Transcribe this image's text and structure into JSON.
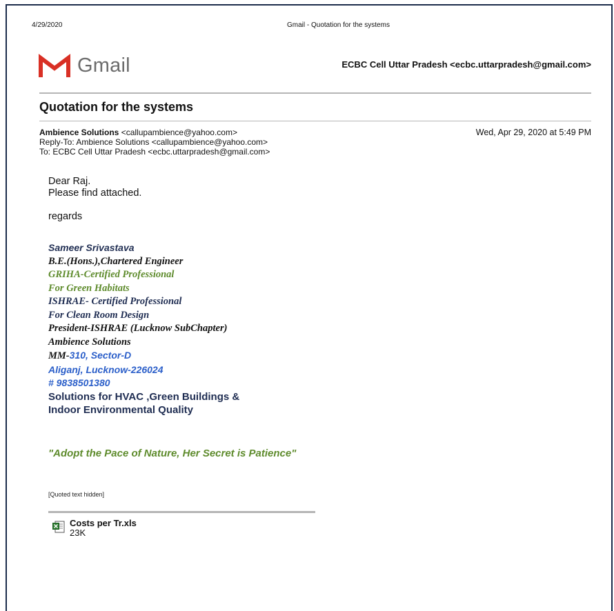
{
  "print_header": {
    "date": "4/29/2020",
    "title": "Gmail - Quotation for the systems"
  },
  "logo": {
    "text": "Gmail",
    "icon": "gmail-m-icon",
    "colors": {
      "red": "#d93025",
      "gray": "#6b6b6b"
    }
  },
  "account": "ECBC Cell Uttar Pradesh <ecbc.uttarpradesh@gmail.com>",
  "subject": "Quotation for the systems",
  "message": {
    "from_name": "Ambience Solutions",
    "from_email": "<callupambience@yahoo.com>",
    "reply_to": "Reply-To: Ambience Solutions <callupambience@yahoo.com>",
    "to": "To: ECBC Cell Uttar Pradesh <ecbc.uttarpradesh@gmail.com>",
    "date": "Wed, Apr 29, 2020 at 5:49 PM",
    "greeting": "Dear Raj.",
    "line1": "Please find attached.",
    "regards": "regards"
  },
  "signature": {
    "name": "Sameer Srivastava",
    "degree": "B.E.(Hons.),Chartered Engineer",
    "griha1": "GRIHA-Certified Professional",
    "griha2": "For Green Habitats",
    "ishrae1": "ISHRAE- Certified Professional",
    "ishrae2": "For Clean Room Design",
    "president": "President-ISHRAE (Lucknow SubChapter)",
    "company": "Ambience Solutions",
    "addr_prefix": "MM-",
    "addr_rest": "310, Sector-D",
    "addr2": "Aliganj, Lucknow-226024",
    "phone": "# 9838501380",
    "tagline1": "Solutions for HVAC ,Green Buildings &",
    "tagline2": "Indoor Environmental Quality",
    "quote": "\"Adopt the Pace of Nature, Her Secret is Patience\""
  },
  "quoted_hidden": "[Quoted text hidden]",
  "attachment": {
    "name": "Costs per Tr.xls",
    "size": "23K",
    "icon": "excel-file-icon"
  }
}
